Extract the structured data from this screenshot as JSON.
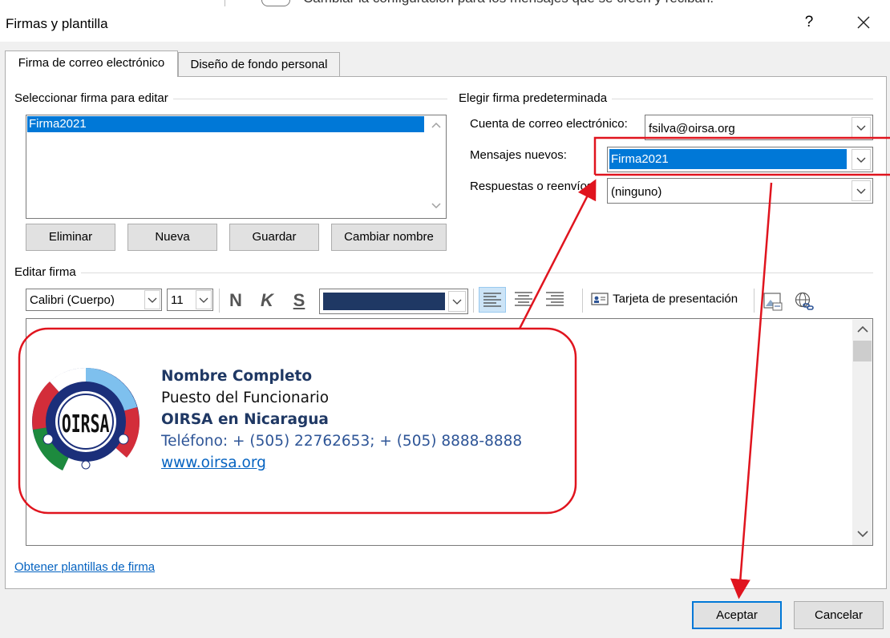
{
  "background_window": {
    "partial_text": "Cambiar la configuración para los mensajes que se creen y reciban."
  },
  "dialog": {
    "title": "Firmas y plantilla",
    "help_label": "?"
  },
  "tabs": [
    {
      "label": "Firma de correo electrónico",
      "active": true
    },
    {
      "label": "Diseño de fondo personal",
      "active": false
    }
  ],
  "select_signature": {
    "label": "Seleccionar firma para editar",
    "items": [
      "Firma2021"
    ],
    "selected": "Firma2021"
  },
  "buttons": {
    "delete": "Eliminar",
    "new": "Nueva",
    "save": "Guardar",
    "rename": "Cambiar nombre"
  },
  "default_signature": {
    "label": "Elegir firma predeterminada",
    "account_label": "Cuenta de correo electrónico:",
    "account_value": "fsilva@oirsa.org",
    "new_messages_label": "Mensajes nuevos:",
    "new_messages_value": "Firma2021",
    "replies_label": "Respuestas o reenvíos:",
    "replies_value": "(ninguno)"
  },
  "edit_signature": {
    "label": "Editar firma",
    "font": "Calibri (Cuerpo)",
    "size": "11",
    "bold_label": "N",
    "italic_label": "K",
    "underline_label": "S",
    "font_color": "#1f3864",
    "business_card_label": "Tarjeta de presentación"
  },
  "signature_content": {
    "logo_text": "OIRSA",
    "name": "Nombre Completo",
    "position": "Puesto del Funcionario",
    "organization": "OIRSA en Nicaragua",
    "phone": "Teléfono: + (505) 22762653; + (505) 8888-8888",
    "website": "www.oirsa.org"
  },
  "templates_link": "Obtener plantillas de firma",
  "footer": {
    "ok": "Aceptar",
    "cancel": "Cancelar"
  },
  "colors": {
    "selection": "#0078d7",
    "annotation": "#e0141e",
    "signature_navy": "#1f3864",
    "link": "#0563c1",
    "phone_text": "#2e5597"
  }
}
